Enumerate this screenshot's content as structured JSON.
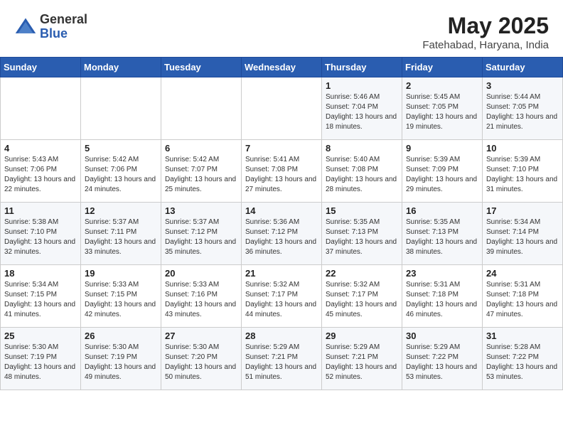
{
  "header": {
    "logo_general": "General",
    "logo_blue": "Blue",
    "month_title": "May 2025",
    "location": "Fatehabad, Haryana, India"
  },
  "days_of_week": [
    "Sunday",
    "Monday",
    "Tuesday",
    "Wednesday",
    "Thursday",
    "Friday",
    "Saturday"
  ],
  "weeks": [
    [
      {
        "day": "",
        "info": ""
      },
      {
        "day": "",
        "info": ""
      },
      {
        "day": "",
        "info": ""
      },
      {
        "day": "",
        "info": ""
      },
      {
        "day": "1",
        "info": "Sunrise: 5:46 AM\nSunset: 7:04 PM\nDaylight: 13 hours and 18 minutes."
      },
      {
        "day": "2",
        "info": "Sunrise: 5:45 AM\nSunset: 7:05 PM\nDaylight: 13 hours and 19 minutes."
      },
      {
        "day": "3",
        "info": "Sunrise: 5:44 AM\nSunset: 7:05 PM\nDaylight: 13 hours and 21 minutes."
      }
    ],
    [
      {
        "day": "4",
        "info": "Sunrise: 5:43 AM\nSunset: 7:06 PM\nDaylight: 13 hours and 22 minutes."
      },
      {
        "day": "5",
        "info": "Sunrise: 5:42 AM\nSunset: 7:06 PM\nDaylight: 13 hours and 24 minutes."
      },
      {
        "day": "6",
        "info": "Sunrise: 5:42 AM\nSunset: 7:07 PM\nDaylight: 13 hours and 25 minutes."
      },
      {
        "day": "7",
        "info": "Sunrise: 5:41 AM\nSunset: 7:08 PM\nDaylight: 13 hours and 27 minutes."
      },
      {
        "day": "8",
        "info": "Sunrise: 5:40 AM\nSunset: 7:08 PM\nDaylight: 13 hours and 28 minutes."
      },
      {
        "day": "9",
        "info": "Sunrise: 5:39 AM\nSunset: 7:09 PM\nDaylight: 13 hours and 29 minutes."
      },
      {
        "day": "10",
        "info": "Sunrise: 5:39 AM\nSunset: 7:10 PM\nDaylight: 13 hours and 31 minutes."
      }
    ],
    [
      {
        "day": "11",
        "info": "Sunrise: 5:38 AM\nSunset: 7:10 PM\nDaylight: 13 hours and 32 minutes."
      },
      {
        "day": "12",
        "info": "Sunrise: 5:37 AM\nSunset: 7:11 PM\nDaylight: 13 hours and 33 minutes."
      },
      {
        "day": "13",
        "info": "Sunrise: 5:37 AM\nSunset: 7:12 PM\nDaylight: 13 hours and 35 minutes."
      },
      {
        "day": "14",
        "info": "Sunrise: 5:36 AM\nSunset: 7:12 PM\nDaylight: 13 hours and 36 minutes."
      },
      {
        "day": "15",
        "info": "Sunrise: 5:35 AM\nSunset: 7:13 PM\nDaylight: 13 hours and 37 minutes."
      },
      {
        "day": "16",
        "info": "Sunrise: 5:35 AM\nSunset: 7:13 PM\nDaylight: 13 hours and 38 minutes."
      },
      {
        "day": "17",
        "info": "Sunrise: 5:34 AM\nSunset: 7:14 PM\nDaylight: 13 hours and 39 minutes."
      }
    ],
    [
      {
        "day": "18",
        "info": "Sunrise: 5:34 AM\nSunset: 7:15 PM\nDaylight: 13 hours and 41 minutes."
      },
      {
        "day": "19",
        "info": "Sunrise: 5:33 AM\nSunset: 7:15 PM\nDaylight: 13 hours and 42 minutes."
      },
      {
        "day": "20",
        "info": "Sunrise: 5:33 AM\nSunset: 7:16 PM\nDaylight: 13 hours and 43 minutes."
      },
      {
        "day": "21",
        "info": "Sunrise: 5:32 AM\nSunset: 7:17 PM\nDaylight: 13 hours and 44 minutes."
      },
      {
        "day": "22",
        "info": "Sunrise: 5:32 AM\nSunset: 7:17 PM\nDaylight: 13 hours and 45 minutes."
      },
      {
        "day": "23",
        "info": "Sunrise: 5:31 AM\nSunset: 7:18 PM\nDaylight: 13 hours and 46 minutes."
      },
      {
        "day": "24",
        "info": "Sunrise: 5:31 AM\nSunset: 7:18 PM\nDaylight: 13 hours and 47 minutes."
      }
    ],
    [
      {
        "day": "25",
        "info": "Sunrise: 5:30 AM\nSunset: 7:19 PM\nDaylight: 13 hours and 48 minutes."
      },
      {
        "day": "26",
        "info": "Sunrise: 5:30 AM\nSunset: 7:19 PM\nDaylight: 13 hours and 49 minutes."
      },
      {
        "day": "27",
        "info": "Sunrise: 5:30 AM\nSunset: 7:20 PM\nDaylight: 13 hours and 50 minutes."
      },
      {
        "day": "28",
        "info": "Sunrise: 5:29 AM\nSunset: 7:21 PM\nDaylight: 13 hours and 51 minutes."
      },
      {
        "day": "29",
        "info": "Sunrise: 5:29 AM\nSunset: 7:21 PM\nDaylight: 13 hours and 52 minutes."
      },
      {
        "day": "30",
        "info": "Sunrise: 5:29 AM\nSunset: 7:22 PM\nDaylight: 13 hours and 53 minutes."
      },
      {
        "day": "31",
        "info": "Sunrise: 5:28 AM\nSunset: 7:22 PM\nDaylight: 13 hours and 53 minutes."
      }
    ]
  ]
}
